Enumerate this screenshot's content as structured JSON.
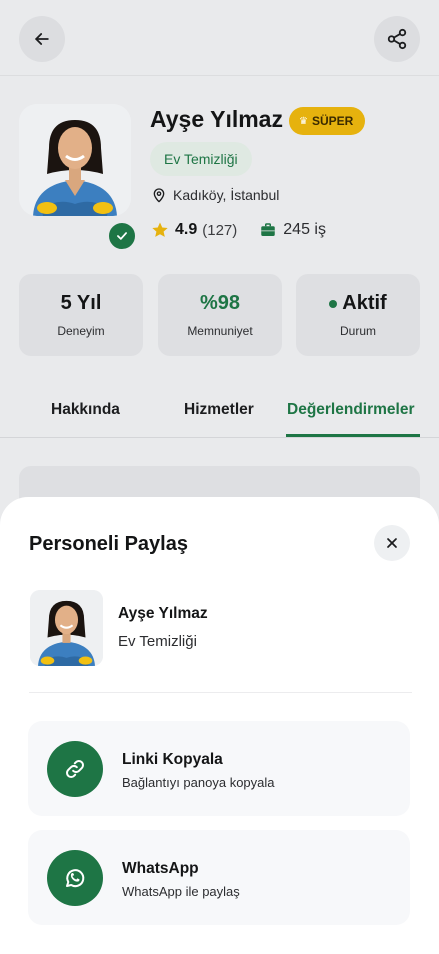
{
  "colors": {
    "accent": "#1e7545",
    "badge": "#e6b20e",
    "chip_bg": "#dfe9e2"
  },
  "header": {
    "back_icon": "arrow-left-icon",
    "share_icon": "share-icon"
  },
  "profile": {
    "name": "Ayşe Yılmaz",
    "badge": "SÜPER",
    "category": "Ev Temizliği",
    "location": "Kadıköy, İstanbul",
    "rating": "4.9",
    "rating_count": "(127)",
    "jobs": "245 iş"
  },
  "stats": [
    {
      "value": "5 Yıl",
      "label": "Deneyim"
    },
    {
      "value": "%98",
      "label": "Memnuniyet"
    },
    {
      "value": "Aktif",
      "label": "Durum"
    }
  ],
  "tabs": [
    {
      "label": "Hakkında",
      "active": false
    },
    {
      "label": "Hizmetler",
      "active": false
    },
    {
      "label": "Değerlendirmeler",
      "active": true
    }
  ],
  "share_sheet": {
    "title": "Personeli Paylaş",
    "person_name": "Ayşe Yılmaz",
    "person_category": "Ev Temizliği",
    "options": [
      {
        "title": "Linki Kopyala",
        "subtitle": "Bağlantıyı panoya kopyala",
        "icon": "link-icon"
      },
      {
        "title": "WhatsApp",
        "subtitle": "WhatsApp ile paylaş",
        "icon": "whatsapp-icon"
      }
    ]
  }
}
